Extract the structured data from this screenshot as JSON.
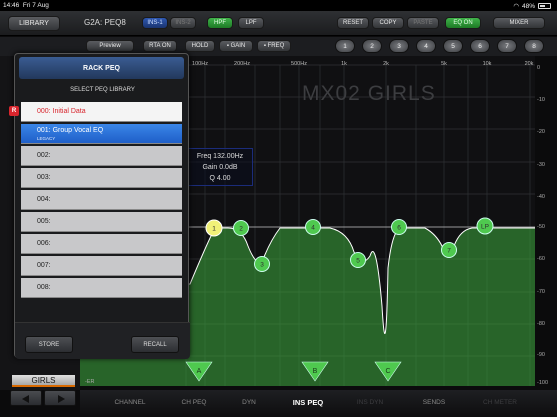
{
  "status_bar": {
    "time": "14:46",
    "date": "Fri 7 Aug",
    "battery": "48%"
  },
  "top_bar": {
    "library_label": "LIBRARY",
    "channel_name": "G2A: PEQ8",
    "ins1_label": "INS-1",
    "ins2_label": "INS-2",
    "hpf_label": "HPF",
    "lpf_label": "LPF",
    "reset_label": "RESET",
    "copy_label": "COPY",
    "paste_label": "PASTE",
    "eq_on_label": "EQ ON",
    "mixer_label": "MIXER"
  },
  "toolbar2": {
    "preview_label": "Preview",
    "rta_label": "RTA ON",
    "hold_label": "HOLD",
    "gain_label": "GAIN",
    "freq_label": "FREQ",
    "band_buttons": [
      "1",
      "2",
      "3",
      "4",
      "5",
      "6",
      "7",
      "8"
    ]
  },
  "graph": {
    "preset_title": "MX02 GIRLS",
    "freq_labels": [
      "100Hz",
      "200Hz",
      "500Hz",
      "1k",
      "2k",
      "5k",
      "10k",
      "20k"
    ],
    "db_labels": [
      "0",
      "-10",
      "-20",
      "-30",
      "-40",
      "-50",
      "-60",
      "-70",
      "-80",
      "-90",
      "-100"
    ],
    "er_label": "-ER",
    "readout": {
      "freq": "Freq  132.00Hz",
      "gain": "Gain  0.0dB",
      "q": "Q  4.00"
    },
    "band_nodes": [
      "1",
      "2",
      "3",
      "4",
      "5",
      "6",
      "7",
      "LP"
    ],
    "bottom_markers": [
      "A",
      "B",
      "C"
    ]
  },
  "left_strip": {
    "channel_label": "GIRLS"
  },
  "rack_peq": {
    "title": "RACK PEQ",
    "subtitle": "SELECT PEQ LIBRARY",
    "badge": "R",
    "items": [
      {
        "label": "000: Initial Data"
      },
      {
        "label": "001: Group Vocal EQ",
        "sub": "LEGACY"
      },
      {
        "label": "002:"
      },
      {
        "label": "003:"
      },
      {
        "label": "004:"
      },
      {
        "label": "005:"
      },
      {
        "label": "006:"
      },
      {
        "label": "007:"
      },
      {
        "label": "008:"
      }
    ],
    "store_label": "STORE",
    "recall_label": "RECALL"
  },
  "bottom_tabs": [
    "CHANNEL",
    "CH PEQ",
    "DYN",
    "INS PEQ",
    "INS DYN",
    "SENDS",
    "CH METER"
  ],
  "colors": {
    "accent_green": "#3fb24a",
    "selected_blue": "#2a74dd",
    "marker_red": "#d8252d",
    "node_yellow": "#f0f078"
  }
}
